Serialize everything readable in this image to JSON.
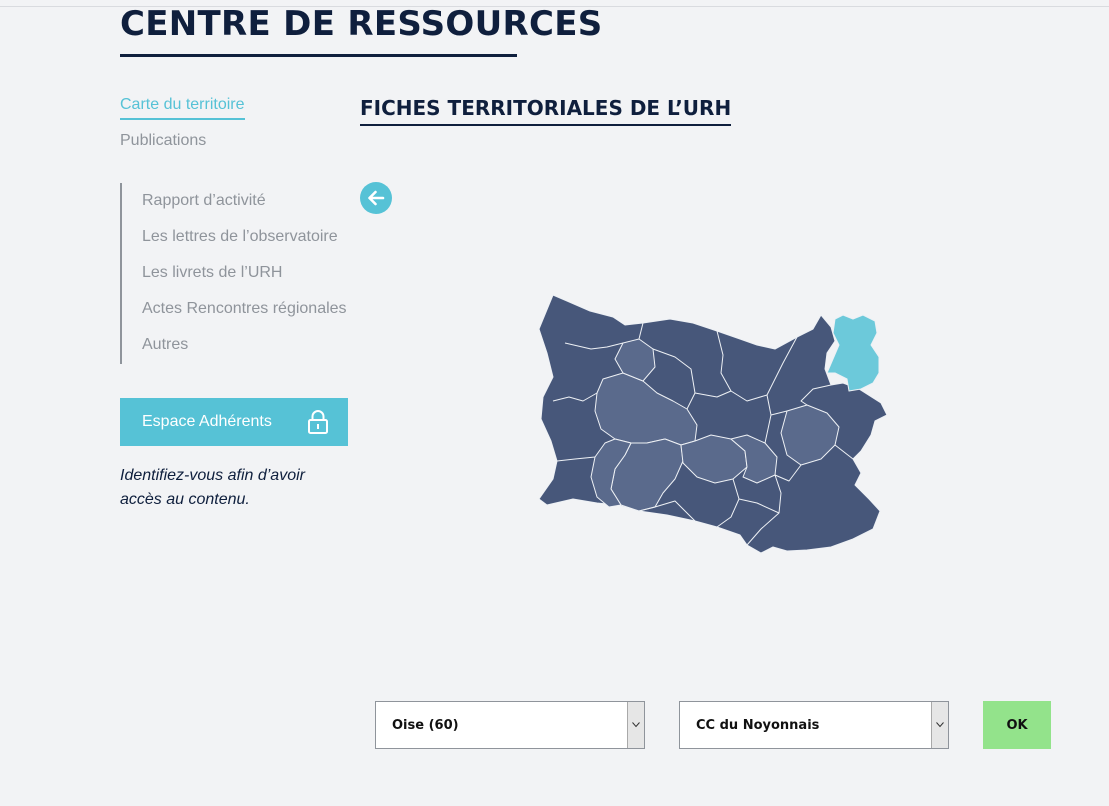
{
  "page": {
    "title": "CENTRE DE RESSOURCES"
  },
  "nav": {
    "main": [
      {
        "label": "Carte du territoire",
        "active": true
      },
      {
        "label": "Publications",
        "active": false
      }
    ],
    "sub": [
      {
        "label": "Rapport d’activité"
      },
      {
        "label": "Les lettres de l’observatoire"
      },
      {
        "label": "Les livrets de l’URH"
      },
      {
        "label": "Actes Rencontres régionales"
      },
      {
        "label": "Autres"
      }
    ]
  },
  "member": {
    "button_label": "Espace Adhérents",
    "note": "Identifiez-vous afin d’avoir accès au contenu."
  },
  "section": {
    "title": "FICHES TERRITORIALES DE L’URH"
  },
  "map": {
    "highlighted_region": "CC du Noyonnais"
  },
  "form": {
    "department_value": "Oise (60)",
    "community_value": "CC du Noyonnais",
    "submit_label": "OK"
  },
  "colors": {
    "accent": "#56c2d6",
    "navy": "#0f1f3d",
    "map_dark": "#47577a",
    "map_medium": "#5a6a8c",
    "map_highlight": "#6cc9da",
    "ok_button": "#93e38b"
  },
  "icons": {
    "lock": "lock-icon",
    "back": "arrow-left-icon",
    "dropdown": "chevron-down-icon"
  }
}
